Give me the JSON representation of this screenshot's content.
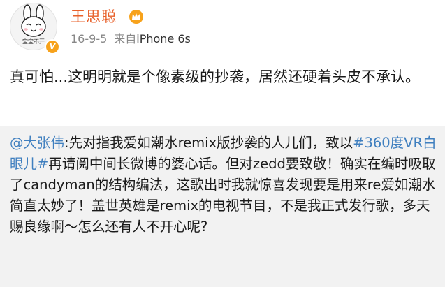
{
  "user": {
    "name": "王思聪",
    "avatar_caption": "宝宝不开"
  },
  "meta": {
    "time": "16-9-5",
    "source_prefix": "来自",
    "source_device": "iPhone 6s"
  },
  "post": {
    "text": "真可怕...这明明就是个像素级的抄袭，居然还硬着头皮不承认。"
  },
  "repost": {
    "mention": "@大张伟",
    "text_1": ":先对指我爱如潮水remix版抄袭的人儿们，致以",
    "hashtag": "#360度VR白眼儿#",
    "text_2": "再请阅中间长微博的婆心话。但对zedd要致敬！确实在编时吸取了candyman的结构编法，这歌出时我就惊喜发现要是用来re爱如潮水简直太妙了！盖世英雄是remix的电视节目，不是我正式发行歌，多天赐良缘啊～怎么还有人不开心呢?"
  },
  "colors": {
    "name": "#e8612b",
    "link": "#3f7fbf",
    "badge": "#f7a21b",
    "repost_bg": "#f2f2f2"
  },
  "icons": {
    "crown": "crown-icon",
    "verified": "verified-badge-icon"
  }
}
